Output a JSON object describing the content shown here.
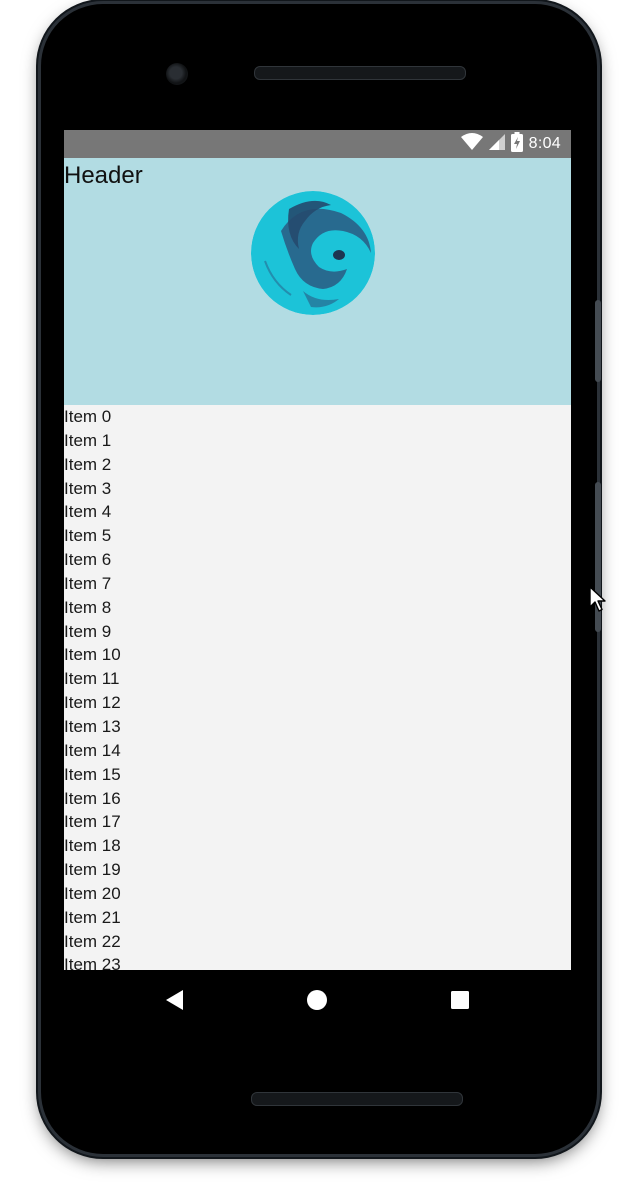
{
  "status_bar": {
    "time": "8:04",
    "icons": [
      "wifi-icon",
      "cell-signal-icon",
      "battery-charging-icon"
    ]
  },
  "header": {
    "title": "Header",
    "avatar_icon": "avatar-image"
  },
  "list": {
    "items": [
      "Item 0",
      "Item 1",
      "Item 2",
      "Item 3",
      "Item 4",
      "Item 5",
      "Item 6",
      "Item 7",
      "Item 8",
      "Item 9",
      "Item 10",
      "Item 11",
      "Item 12",
      "Item 13",
      "Item 14",
      "Item 15",
      "Item 16",
      "Item 17",
      "Item 18",
      "Item 19",
      "Item 20",
      "Item 21",
      "Item 22",
      "Item 23"
    ]
  },
  "nav_bar": {
    "buttons": [
      "back-icon",
      "home-icon",
      "recents-icon"
    ]
  },
  "colors": {
    "status_bar": "#777777",
    "header_bg": "#b2dce3",
    "list_bg": "#f3f3f3",
    "avatar": "#1cc3d8"
  }
}
